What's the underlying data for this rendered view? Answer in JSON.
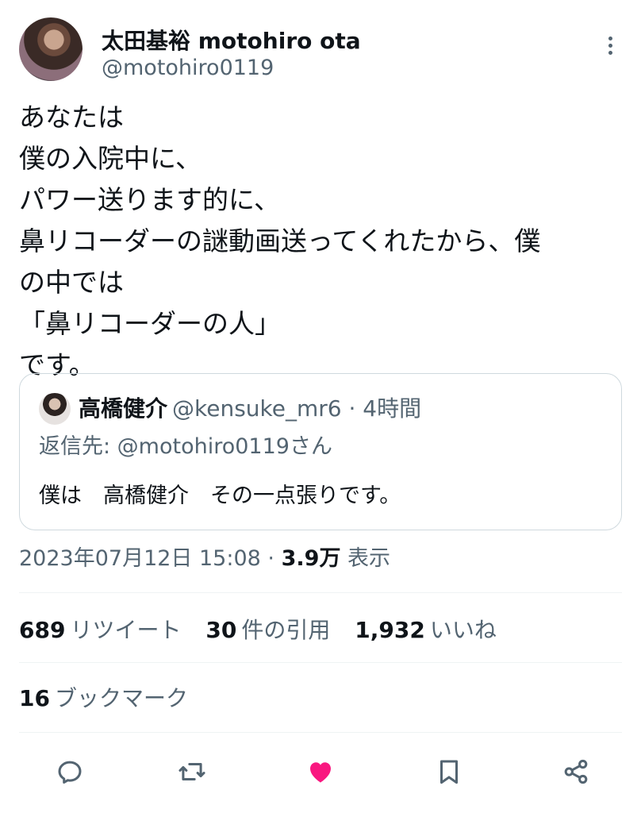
{
  "author": {
    "display_name": "太田基裕 motohiro ota",
    "handle": "@motohiro0119"
  },
  "tweet": {
    "lines": [
      "あなたは",
      "僕の入院中に、",
      "パワー送ります的に、",
      "鼻リコーダーの謎動画送ってくれたから、僕",
      "の中では",
      "「鼻リコーダーの人」",
      "です。"
    ]
  },
  "quote": {
    "name": "高橋健介",
    "meta": "@kensuke_mr6 · 4時間",
    "reply_to": "返信先: @motohiro0119さん",
    "text": "僕は　高橋健介　その一点張りです。"
  },
  "meta": {
    "timestamp": "2023年07月12日 15:08",
    "separator": "·",
    "views": "3.9万",
    "views_label": "表示"
  },
  "stats": {
    "retweets": "689",
    "retweets_label": "リツイート",
    "quotes": "30",
    "quotes_label": "件の引用",
    "likes": "1,932",
    "likes_label": "いいね"
  },
  "bookmarks": {
    "count": "16",
    "label": "ブックマーク"
  },
  "actions": {
    "reply_icon": "reply-icon",
    "retweet_icon": "retweet-icon",
    "like_icon": "heart-filled-icon",
    "bookmark_icon": "bookmark-icon",
    "share_icon": "share-icon"
  },
  "colors": {
    "text": "#0f1419",
    "secondary": "#536471",
    "like": "#f91880",
    "divider": "#eff3f4"
  }
}
